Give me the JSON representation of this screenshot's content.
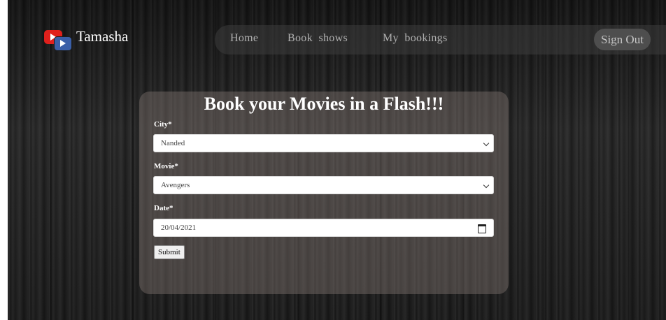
{
  "brand": {
    "name": "Tamasha",
    "logo": "youtube-style-play-logo"
  },
  "nav": {
    "home": "Home",
    "book_shows": "Book  shows",
    "my_bookings": "My  bookings",
    "sign_out": "Sign  Out"
  },
  "form": {
    "title": "Book your Movies in a Flash!!!",
    "city_label": "City*",
    "city_value": "Nanded",
    "movie_label": "Movie*",
    "movie_value": "Avengers",
    "date_label": "Date*",
    "date_value": "20/04/2021",
    "submit_label": "Submit"
  },
  "colors": {
    "background": "#1b1b1b",
    "logo_red": "#e0201c",
    "logo_blue": "#3a5fa8",
    "card": "#827673"
  }
}
